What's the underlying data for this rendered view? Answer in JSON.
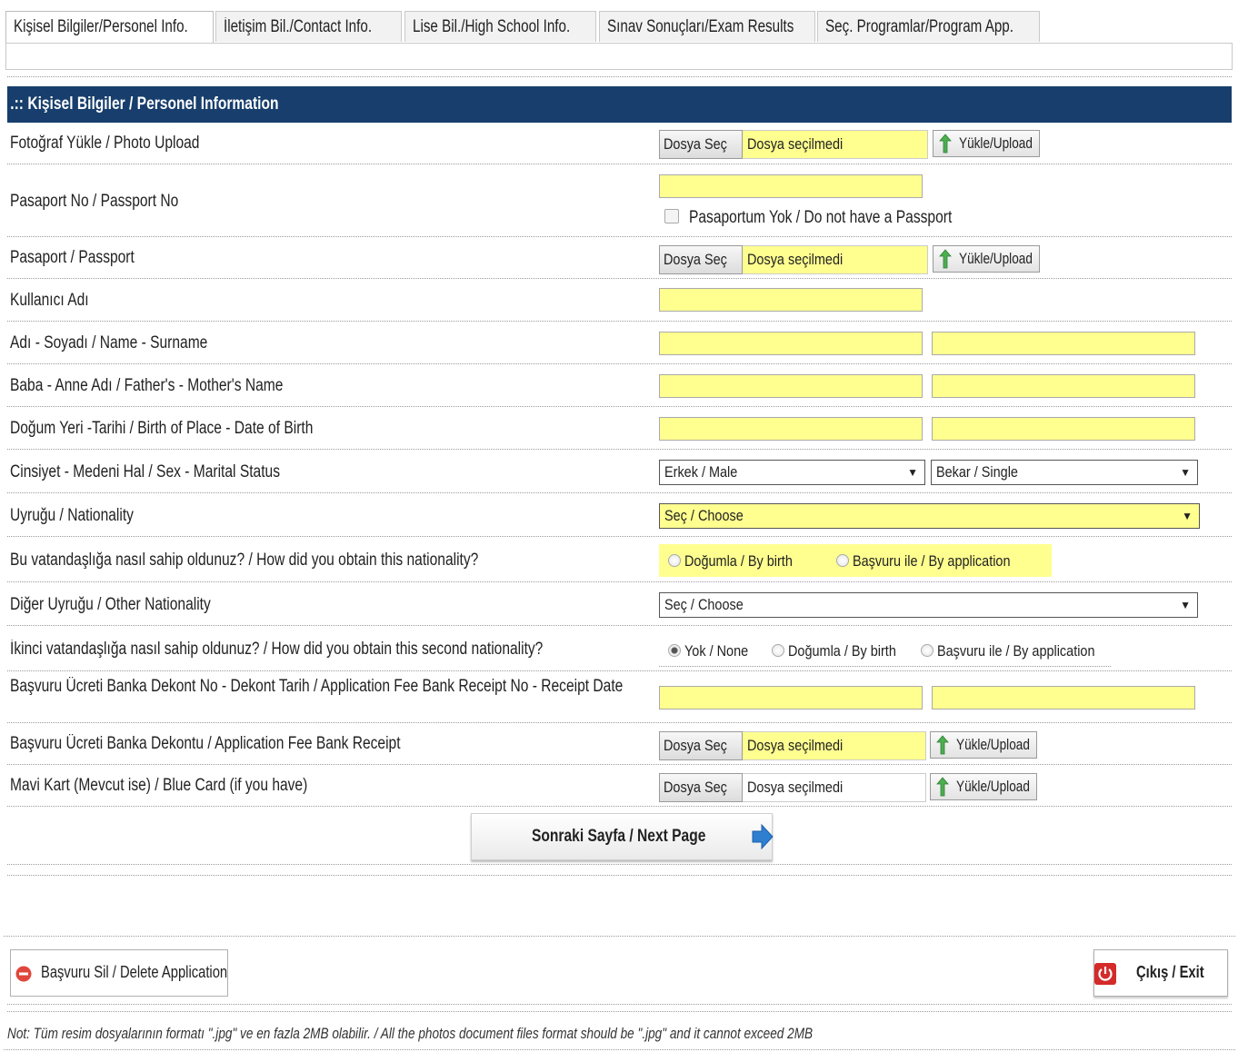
{
  "tabs": [
    {
      "label": "Kişisel Bilgiler/Personel Info."
    },
    {
      "label": "İletişim Bil./Contact Info."
    },
    {
      "label": "Lise Bil./High School Info."
    },
    {
      "label": "Sınav Sonuçları/Exam Results"
    },
    {
      "label": "Seç. Programlar/Program App."
    }
  ],
  "section_title": ".:: Kişisel Bilgiler / Personel Information",
  "file_controls": {
    "choose_label": "Dosya Seç",
    "no_file_label": "Dosya seçilmedi",
    "upload_label": "Yükle/Upload"
  },
  "form": {
    "photo_label": "Fotoğraf Yükle / Photo Upload",
    "passport_no_label": "Pasaport No / Passport No",
    "no_passport_label": "Pasaportum Yok / Do not have a Passport",
    "passport_label": "Pasaport / Passport",
    "username_label": "Kullanıcı Adı",
    "name_label": "Adı - Soyadı / Name - Surname",
    "parents_label": "Baba - Anne Adı / Father's - Mother's Name",
    "birth_label": "Doğum Yeri -Tarihi / Birth of Place - Date of Birth",
    "sex_label": "Cinsiyet - Medeni Hal / Sex - Marital Status",
    "sex_value": "Erkek / Male",
    "marital_value": "Bekar / Single",
    "nationality_label": "Uyruğu / Nationality",
    "nationality_value": "Seç / Choose",
    "obtain_label": "Bu vatandaşlığa nasıl sahip oldunuz? / How did you obtain this nationality?",
    "by_birth": "Doğumla / By birth",
    "by_application": "Başvuru ile / By application",
    "other_nationality_label": "Diğer Uyruğu / Other Nationality",
    "other_nationality_value": "Seç / Choose",
    "second_obtain_label": "İkinci vatandaşlığa nasıl sahip oldunuz? / How did you obtain this second nationality?",
    "none": "Yok / None",
    "receipt_no_label": "Başvuru Ücreti Banka Dekont No - Dekont Tarih / Application Fee Bank Receipt No - Receipt Date",
    "receipt_file_label": "Başvuru Ücreti Banka Dekontu / Application Fee Bank Receipt",
    "blue_card_label": "Mavi Kart (Mevcut ise) / Blue Card (if you have)"
  },
  "next_button": "Sonraki Sayfa / Next Page",
  "delete_button": "Başvuru Sil / Delete Application",
  "exit_button": "Çıkış / Exit",
  "note": "Not: Tüm resim dosyalarının formatı \".jpg\" ve en fazla 2MB olabilir. / All the photos document files format should be \".jpg\" and it cannot exceed 2MB",
  "colors": {
    "header": "#173e6c",
    "field": "#ffff90",
    "upload_arrow": "#4caf50",
    "next_arrow": "#2f7fd1",
    "delete_icon": "#e0463c",
    "exit_icon": "#d42a2a"
  },
  "icons": [
    "upload-arrow-icon",
    "next-arrow-icon",
    "delete-icon",
    "power-icon"
  ]
}
